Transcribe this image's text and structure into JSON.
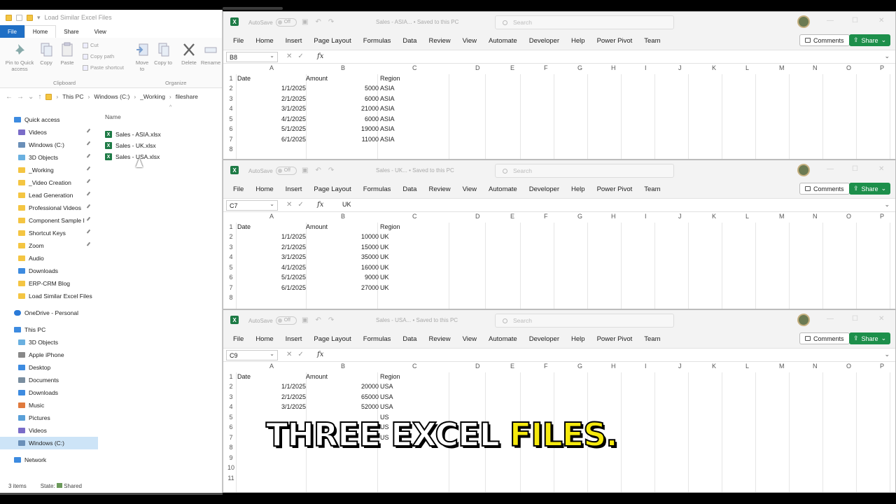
{
  "explorer": {
    "title": "Load Similar Excel Files",
    "tabs": [
      "File",
      "Home",
      "Share",
      "View"
    ],
    "ribbon": {
      "pin": "Pin to Quick access",
      "copy": "Copy",
      "paste": "Paste",
      "cut": "Cut",
      "copy_path": "Copy path",
      "paste_shortcut": "Paste shortcut",
      "move_to": "Move to",
      "copy_to": "Copy to",
      "delete": "Delete",
      "rename": "Rename",
      "clipboard": "Clipboard",
      "organize": "Organize"
    },
    "breadcrumb": [
      "This PC",
      "Windows (C:)",
      "_Working",
      "fileshare"
    ],
    "quick_access": "Quick access",
    "quick_items": [
      {
        "label": "Videos",
        "pinned": true,
        "color": "#7a6cc8"
      },
      {
        "label": "Windows (C:)",
        "pinned": true,
        "color": "#6a8fb8"
      },
      {
        "label": "3D Objects",
        "pinned": true,
        "color": "#6ab0e0"
      },
      {
        "label": "_Working",
        "pinned": true,
        "color": "#f4c542"
      },
      {
        "label": "_Video Creation",
        "pinned": true,
        "color": "#f4c542"
      },
      {
        "label": "Lead Generation",
        "pinned": true,
        "color": "#f4c542"
      },
      {
        "label": "Professional Videos",
        "pinned": true,
        "color": "#f4c542"
      },
      {
        "label": "Component Sample I",
        "pinned": true,
        "color": "#f4c542"
      },
      {
        "label": "Shortcut Keys",
        "pinned": true,
        "color": "#f4c542"
      },
      {
        "label": "Zoom",
        "pinned": true,
        "color": "#f4c542"
      },
      {
        "label": "Audio",
        "pinned": false,
        "color": "#f4c542"
      },
      {
        "label": "Downloads",
        "pinned": false,
        "color": "#3d8be0"
      },
      {
        "label": "ERP-CRM Blog",
        "pinned": false,
        "color": "#f4c542"
      },
      {
        "label": "Load Similar Excel Files",
        "pinned": false,
        "color": "#f4c542"
      }
    ],
    "onedrive": "OneDrive - Personal",
    "this_pc": "This PC",
    "pc_items": [
      {
        "label": "3D Objects",
        "color": "#6ab0e0"
      },
      {
        "label": "Apple iPhone",
        "color": "#888888"
      },
      {
        "label": "Desktop",
        "color": "#3d8be0"
      },
      {
        "label": "Documents",
        "color": "#7a8ea0"
      },
      {
        "label": "Downloads",
        "color": "#3d8be0"
      },
      {
        "label": "Music",
        "color": "#e07a3d"
      },
      {
        "label": "Pictures",
        "color": "#5aa0d8"
      },
      {
        "label": "Videos",
        "color": "#7a6cc8"
      },
      {
        "label": "Windows (C:)",
        "color": "#6a8fb8"
      }
    ],
    "network": "Network",
    "column_name": "Name",
    "files": [
      "Sales - ASIA.xlsx",
      "Sales - UK.xlsx",
      "Sales - USA.xlsx"
    ],
    "status_items": "3 items",
    "status_state": "State:",
    "status_shared": "Shared"
  },
  "excel_common": {
    "autosave": "AutoSave",
    "toggle": "Off",
    "search": "Search",
    "menu": [
      "File",
      "Home",
      "Insert",
      "Page Layout",
      "Formulas",
      "Data",
      "Review",
      "View",
      "Automate",
      "Developer",
      "Help",
      "Power Pivot",
      "Team"
    ],
    "comments": "Comments",
    "share": "Share",
    "fx": "fx",
    "columns": [
      "A",
      "B",
      "C",
      "D",
      "E",
      "F",
      "G",
      "H",
      "I",
      "J",
      "K",
      "L",
      "M",
      "N",
      "O",
      "P"
    ]
  },
  "windows": [
    {
      "file_title": "Sales - ASIA... • Saved to this PC",
      "cell_ref": "B8",
      "formula": "",
      "headers": [
        "Date",
        "Amount",
        "Region"
      ],
      "rows": [
        [
          "1/1/2025",
          "5000",
          "ASIA"
        ],
        [
          "2/1/2025",
          "6000",
          "ASIA"
        ],
        [
          "3/1/2025",
          "21000",
          "ASIA"
        ],
        [
          "4/1/2025",
          "6000",
          "ASIA"
        ],
        [
          "5/1/2025",
          "19000",
          "ASIA"
        ],
        [
          "6/1/2025",
          "11000",
          "ASIA"
        ]
      ]
    },
    {
      "file_title": "Sales - UK... • Saved to this PC",
      "cell_ref": "C7",
      "formula": "UK",
      "headers": [
        "Date",
        "Amount",
        "Region"
      ],
      "rows": [
        [
          "1/1/2025",
          "10000",
          "UK"
        ],
        [
          "2/1/2025",
          "15000",
          "UK"
        ],
        [
          "3/1/2025",
          "35000",
          "UK"
        ],
        [
          "4/1/2025",
          "16000",
          "UK"
        ],
        [
          "5/1/2025",
          "9000",
          "UK"
        ],
        [
          "6/1/2025",
          "27000",
          "UK"
        ]
      ]
    },
    {
      "file_title": "Sales - USA... • Saved to this PC",
      "cell_ref": "C9",
      "formula": "",
      "headers": [
        "Date",
        "Amount",
        "Region"
      ],
      "rows": [
        [
          "1/1/2025",
          "20000",
          "USA"
        ],
        [
          "2/1/2025",
          "65000",
          "USA"
        ],
        [
          "3/1/2025",
          "52000",
          "USA"
        ],
        [
          "",
          "",
          "US"
        ],
        [
          "",
          "",
          "US"
        ],
        [
          "",
          "",
          "US"
        ]
      ],
      "row_numbers": [
        "1",
        "2",
        "3",
        "4",
        "5",
        "6",
        "7",
        "8",
        "9",
        "10",
        "11"
      ]
    }
  ],
  "caption": {
    "part1": "THREE EXCEL",
    "part2": "FILES."
  }
}
